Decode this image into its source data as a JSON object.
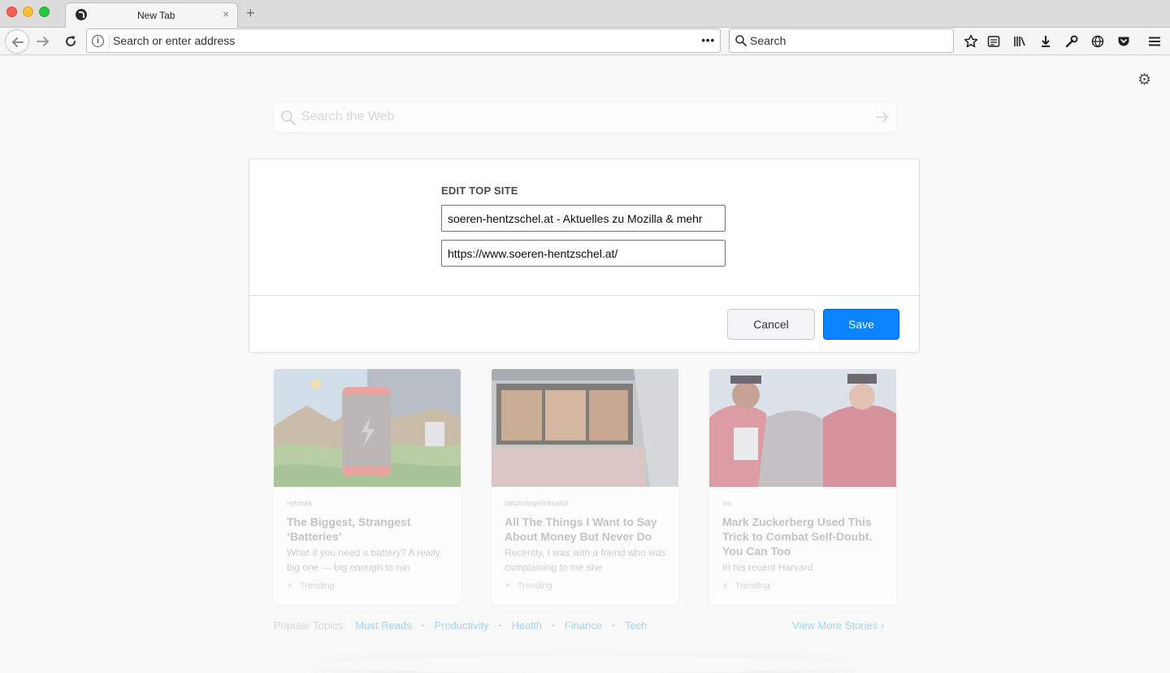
{
  "browser": {
    "tab_title": "New Tab",
    "tab_close": "×",
    "new_tab": "+",
    "url_placeholder": "Search or enter address",
    "page_actions": "•••",
    "search_placeholder": "Search"
  },
  "newtab": {
    "web_search_placeholder": "Search the Web"
  },
  "modal": {
    "title": "EDIT TOP SITE",
    "title_value": "soeren-hentzschel.at - Aktuelles zu Mozilla & mehr",
    "url_value": "https://www.soeren-hentzschel.at/",
    "cancel_label": "Cancel",
    "save_label": "Save"
  },
  "cards": [
    {
      "source": "nytimes",
      "title": "The Biggest, Strangest ‘Batteries’",
      "desc": "What if you need a battery? A really big one — big enough to run",
      "trend": "Trending"
    },
    {
      "source": "becomingminimalist",
      "title": "All The Things I Want to Say About Money But Never Do",
      "desc": "Recently, I was with a friend who was complaining to me she",
      "trend": "Trending"
    },
    {
      "source": "inc",
      "title": "Mark Zuckerberg Used This Trick to Combat Self-Doubt. You Can Too",
      "desc": "In his recent Harvard",
      "trend": "Trending"
    }
  ],
  "topics": {
    "label": "Popular Topics:",
    "items": [
      "Must Reads",
      "Productivity",
      "Health",
      "Finance",
      "Tech"
    ],
    "separator": "•",
    "more_label": "View More Stories",
    "more_arrow": "›"
  },
  "colors": {
    "accent": "#0a84ff",
    "link_faded": "#a6d4f5"
  }
}
